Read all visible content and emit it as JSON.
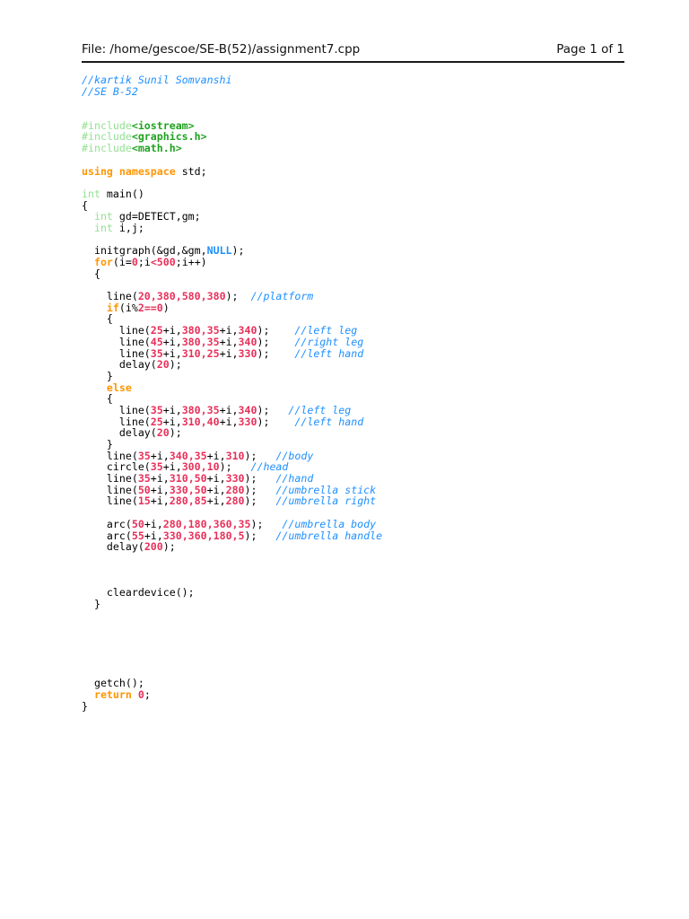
{
  "header": {
    "file_label": "File: /home/gescoe/SE-B(52)/assignment7.cpp",
    "page_label": "Page 1 of 1"
  },
  "colors": {
    "comment": "#1e90ff",
    "pale_green": "#92e192",
    "green": "#1fa31f",
    "orange": "#ff9500",
    "number": "#e8305a",
    "blue": "#1e90ff",
    "plain": "#000000",
    "rule": "#1a1a1a",
    "page_background": "#ffffff"
  },
  "code": {
    "language": "cpp",
    "lines": [
      [
        [
          "c",
          "//kartik Sunil Somvanshi"
        ]
      ],
      [
        [
          "c",
          "//SE B-52"
        ]
      ],
      [],
      [],
      [
        [
          "pre",
          "#include"
        ],
        [
          "inc",
          "<iostream>"
        ]
      ],
      [
        [
          "pre",
          "#include"
        ],
        [
          "inc",
          "<graphics.h>"
        ]
      ],
      [
        [
          "pre",
          "#include"
        ],
        [
          "inc",
          "<math.h>"
        ]
      ],
      [],
      [
        [
          "k",
          "using"
        ],
        [
          "p",
          " "
        ],
        [
          "k",
          "namespace"
        ],
        [
          "p",
          " std;"
        ]
      ],
      [],
      [
        [
          "pre",
          "int"
        ],
        [
          "p",
          " main()"
        ]
      ],
      [
        [
          "p",
          "{"
        ]
      ],
      [
        [
          "p",
          "  "
        ],
        [
          "pre",
          "int"
        ],
        [
          "p",
          " gd=DETECT,gm;"
        ]
      ],
      [
        [
          "p",
          "  "
        ],
        [
          "pre",
          "int"
        ],
        [
          "p",
          " i,j;"
        ]
      ],
      [],
      [
        [
          "p",
          "  initgraph(&gd,&gm,"
        ],
        [
          "b",
          "NULL"
        ],
        [
          "p",
          ");"
        ]
      ],
      [
        [
          "p",
          "  "
        ],
        [
          "k",
          "for"
        ],
        [
          "p",
          "(i="
        ],
        [
          "n",
          "0"
        ],
        [
          "p",
          ";i"
        ],
        [
          "n",
          "<500"
        ],
        [
          "p",
          ";i++)"
        ]
      ],
      [
        [
          "p",
          "  {"
        ]
      ],
      [],
      [
        [
          "p",
          "    line("
        ],
        [
          "n",
          "20,380,580,380"
        ],
        [
          "p",
          ");  "
        ],
        [
          "c",
          "//platform"
        ]
      ],
      [
        [
          "p",
          "    "
        ],
        [
          "k",
          "if"
        ],
        [
          "p",
          "(i%"
        ],
        [
          "n",
          "2==0"
        ],
        [
          "p",
          ")"
        ]
      ],
      [
        [
          "p",
          "    {"
        ]
      ],
      [
        [
          "p",
          "      line("
        ],
        [
          "n",
          "25"
        ],
        [
          "p",
          "+i,"
        ],
        [
          "n",
          "380,35"
        ],
        [
          "p",
          "+i,"
        ],
        [
          "n",
          "340"
        ],
        [
          "p",
          ");    "
        ],
        [
          "c",
          "//left leg"
        ]
      ],
      [
        [
          "p",
          "      line("
        ],
        [
          "n",
          "45"
        ],
        [
          "p",
          "+i,"
        ],
        [
          "n",
          "380,35"
        ],
        [
          "p",
          "+i,"
        ],
        [
          "n",
          "340"
        ],
        [
          "p",
          ");    "
        ],
        [
          "c",
          "//right leg"
        ]
      ],
      [
        [
          "p",
          "      line("
        ],
        [
          "n",
          "35"
        ],
        [
          "p",
          "+i,"
        ],
        [
          "n",
          "310,25"
        ],
        [
          "p",
          "+i,"
        ],
        [
          "n",
          "330"
        ],
        [
          "p",
          ");    "
        ],
        [
          "c",
          "//left hand"
        ]
      ],
      [
        [
          "p",
          "      delay("
        ],
        [
          "n",
          "20"
        ],
        [
          "p",
          ");"
        ]
      ],
      [
        [
          "p",
          "    }"
        ]
      ],
      [
        [
          "p",
          "    "
        ],
        [
          "k",
          "else"
        ]
      ],
      [
        [
          "p",
          "    {"
        ]
      ],
      [
        [
          "p",
          "      line("
        ],
        [
          "n",
          "35"
        ],
        [
          "p",
          "+i,"
        ],
        [
          "n",
          "380,35"
        ],
        [
          "p",
          "+i,"
        ],
        [
          "n",
          "340"
        ],
        [
          "p",
          ");   "
        ],
        [
          "c",
          "//left leg"
        ]
      ],
      [
        [
          "p",
          "      line("
        ],
        [
          "n",
          "25"
        ],
        [
          "p",
          "+i,"
        ],
        [
          "n",
          "310,40"
        ],
        [
          "p",
          "+i,"
        ],
        [
          "n",
          "330"
        ],
        [
          "p",
          ");    "
        ],
        [
          "c",
          "//left hand"
        ]
      ],
      [
        [
          "p",
          "      delay("
        ],
        [
          "n",
          "20"
        ],
        [
          "p",
          ");"
        ]
      ],
      [
        [
          "p",
          "    }"
        ]
      ],
      [
        [
          "p",
          "    line("
        ],
        [
          "n",
          "35"
        ],
        [
          "p",
          "+i,"
        ],
        [
          "n",
          "340,35"
        ],
        [
          "p",
          "+i,"
        ],
        [
          "n",
          "310"
        ],
        [
          "p",
          ");   "
        ],
        [
          "c",
          "//body"
        ]
      ],
      [
        [
          "p",
          "    circle("
        ],
        [
          "n",
          "35"
        ],
        [
          "p",
          "+i,"
        ],
        [
          "n",
          "300,10"
        ],
        [
          "p",
          ");   "
        ],
        [
          "c",
          "//head"
        ]
      ],
      [
        [
          "p",
          "    line("
        ],
        [
          "n",
          "35"
        ],
        [
          "p",
          "+i,"
        ],
        [
          "n",
          "310,50"
        ],
        [
          "p",
          "+i,"
        ],
        [
          "n",
          "330"
        ],
        [
          "p",
          ");   "
        ],
        [
          "c",
          "//hand"
        ]
      ],
      [
        [
          "p",
          "    line("
        ],
        [
          "n",
          "50"
        ],
        [
          "p",
          "+i,"
        ],
        [
          "n",
          "330,50"
        ],
        [
          "p",
          "+i,"
        ],
        [
          "n",
          "280"
        ],
        [
          "p",
          ");   "
        ],
        [
          "c",
          "//umbrella stick"
        ]
      ],
      [
        [
          "p",
          "    line("
        ],
        [
          "n",
          "15"
        ],
        [
          "p",
          "+i,"
        ],
        [
          "n",
          "280,85"
        ],
        [
          "p",
          "+i,"
        ],
        [
          "n",
          "280"
        ],
        [
          "p",
          ");   "
        ],
        [
          "c",
          "//umbrella right"
        ]
      ],
      [],
      [
        [
          "p",
          "    arc("
        ],
        [
          "n",
          "50"
        ],
        [
          "p",
          "+i,"
        ],
        [
          "n",
          "280,180,360,35"
        ],
        [
          "p",
          ");   "
        ],
        [
          "c",
          "//umbrella body"
        ]
      ],
      [
        [
          "p",
          "    arc("
        ],
        [
          "n",
          "55"
        ],
        [
          "p",
          "+i,"
        ],
        [
          "n",
          "330,360,180,5"
        ],
        [
          "p",
          ");   "
        ],
        [
          "c",
          "//umbrella handle"
        ]
      ],
      [
        [
          "p",
          "    delay("
        ],
        [
          "n",
          "200"
        ],
        [
          "p",
          ");"
        ]
      ],
      [],
      [],
      [],
      [
        [
          "p",
          "    cleardevice();"
        ]
      ],
      [
        [
          "p",
          "  }"
        ]
      ],
      [],
      [],
      [],
      [],
      [],
      [],
      [
        [
          "p",
          "  getch();"
        ]
      ],
      [
        [
          "p",
          "  "
        ],
        [
          "k",
          "return"
        ],
        [
          "p",
          " "
        ],
        [
          "n",
          "0"
        ],
        [
          "p",
          ";"
        ]
      ],
      [
        [
          "p",
          "}"
        ]
      ]
    ]
  }
}
